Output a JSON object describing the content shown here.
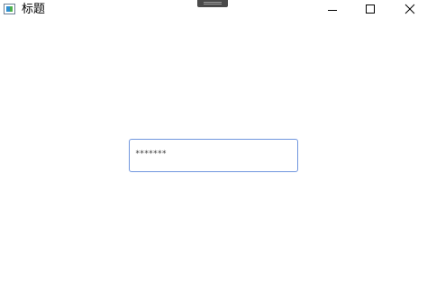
{
  "window": {
    "title": "标题",
    "app_icon": "window-app-icon",
    "controls": {
      "minimize_icon": "minimize-icon",
      "maximize_icon": "maximize-icon",
      "close_icon": "close-icon"
    }
  },
  "password_field": {
    "masked_value": "*******"
  },
  "colors": {
    "focus_border": "#6f95de",
    "background": "#ffffff"
  }
}
